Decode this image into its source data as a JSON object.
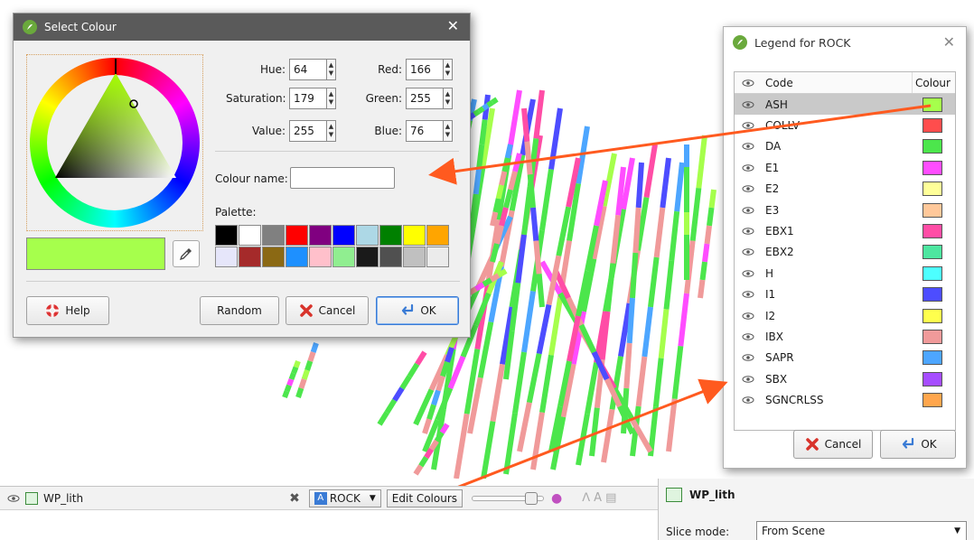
{
  "select_colour": {
    "title": "Select Colour",
    "fields": {
      "hue_label": "Hue:",
      "hue_value": "64",
      "saturation_label": "Saturation:",
      "saturation_value": "179",
      "value_label": "Value:",
      "value_value": "255",
      "red_label": "Red:",
      "red_value": "166",
      "green_label": "Green:",
      "green_value": "255",
      "blue_label": "Blue:",
      "blue_value": "76"
    },
    "colour_name_label": "Colour name:",
    "colour_name_value": "",
    "palette_label": "Palette:",
    "palette": [
      "#000000",
      "#ffffff",
      "#808080",
      "#ff0000",
      "#800080",
      "#0000ff",
      "#add8e6",
      "#008000",
      "#ffff00",
      "#ffa500",
      "#e6e6fa",
      "#a52a2a",
      "#8b6914",
      "#1e90ff",
      "#ffc0cb",
      "#90ee90",
      "#1a1a1a",
      "#505050",
      "#c0c0c0",
      "#ebebeb"
    ],
    "selected_colour": "#a6ff4c",
    "buttons": {
      "help": "Help",
      "random": "Random",
      "cancel": "Cancel",
      "ok": "OK"
    }
  },
  "legend": {
    "title": "Legend for ROCK",
    "header_code": "Code",
    "header_colour": "Colour",
    "rows": [
      {
        "code": "ASH",
        "color": "#a6ff4c",
        "selected": true
      },
      {
        "code": "COLLV",
        "color": "#ff4d4d"
      },
      {
        "code": "DA",
        "color": "#4ce64c"
      },
      {
        "code": "E1",
        "color": "#ff4dff"
      },
      {
        "code": "E2",
        "color": "#ffff99"
      },
      {
        "code": "E3",
        "color": "#ffc89a"
      },
      {
        "code": "EBX1",
        "color": "#ff4da6"
      },
      {
        "code": "EBX2",
        "color": "#4de6a0"
      },
      {
        "code": "H",
        "color": "#4dffff"
      },
      {
        "code": "I1",
        "color": "#4d4dff"
      },
      {
        "code": "I2",
        "color": "#ffff4d"
      },
      {
        "code": "IBX",
        "color": "#f09a9a"
      },
      {
        "code": "SAPR",
        "color": "#4da6ff"
      },
      {
        "code": "SBX",
        "color": "#a64dff"
      },
      {
        "code": "SGNCRLSS",
        "color": "#ffa64d"
      }
    ],
    "buttons": {
      "cancel": "Cancel",
      "ok": "OK"
    }
  },
  "bottom_bar": {
    "object_name": "WP_lith",
    "column_value": "ROCK",
    "edit_colours_label": "Edit Colours"
  },
  "properties": {
    "title": "WP_lith",
    "slice_mode_label": "Slice mode:",
    "slice_mode_value": "From Scene"
  },
  "colors": {
    "title_bar": "#5a5a5a",
    "annotation_arrow": "#ff5a1f",
    "default_button_border": "#3a7bd5"
  }
}
